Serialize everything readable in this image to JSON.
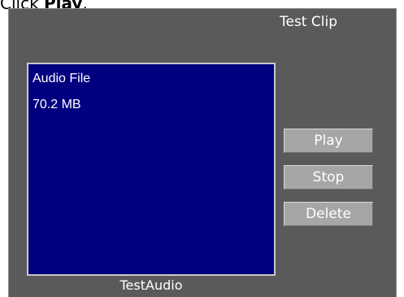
{
  "instruction": {
    "prefix": "Click ",
    "action": "Play",
    "suffix": "."
  },
  "panel": {
    "title": "Test Clip",
    "thumbnail": {
      "type_label": "Audio File",
      "size_label": "70.2 MB"
    },
    "clip_name": "TestAudio",
    "buttons": {
      "play": "Play",
      "stop": "Stop",
      "delete": "Delete"
    }
  },
  "colors": {
    "panel_bg": "#5a5a5a",
    "thumbnail_bg": "#000080",
    "button_bg": "#a6a6a6"
  }
}
